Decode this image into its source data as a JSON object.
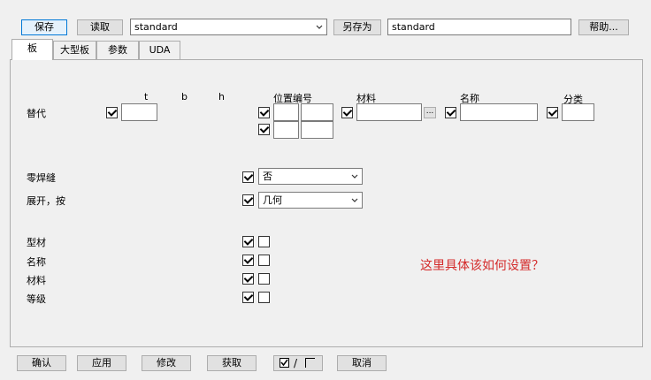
{
  "toolbar": {
    "save_label": "保存",
    "load_label": "读取",
    "preset_value": "standard",
    "save_as_label": "另存为",
    "save_as_value": "standard",
    "help_label": "帮助..."
  },
  "tabs": [
    {
      "label": "板"
    },
    {
      "label": "大型板"
    },
    {
      "label": "参数"
    },
    {
      "label": "UDA"
    }
  ],
  "headers": {
    "t": "t",
    "b": "b",
    "h": "h",
    "position_number": "位置编号",
    "material": "材料",
    "name": "名称",
    "class": "分类"
  },
  "rows": {
    "replace": "替代",
    "zero_weld": "零焊缝",
    "unfold_by": "展开，按",
    "profile": "型材",
    "name": "名称",
    "material": "材料",
    "grade": "等级"
  },
  "fields": {
    "zero_weld_value": "否",
    "unfold_value": "几何",
    "browse_label": "..."
  },
  "annotation": "这里具体该如何设置？",
  "bottom": {
    "ok_label": "确认",
    "apply_label": "应用",
    "modify_label": "修改",
    "get_label": "获取",
    "toggle_separator": "/",
    "cancel_label": "取消"
  }
}
